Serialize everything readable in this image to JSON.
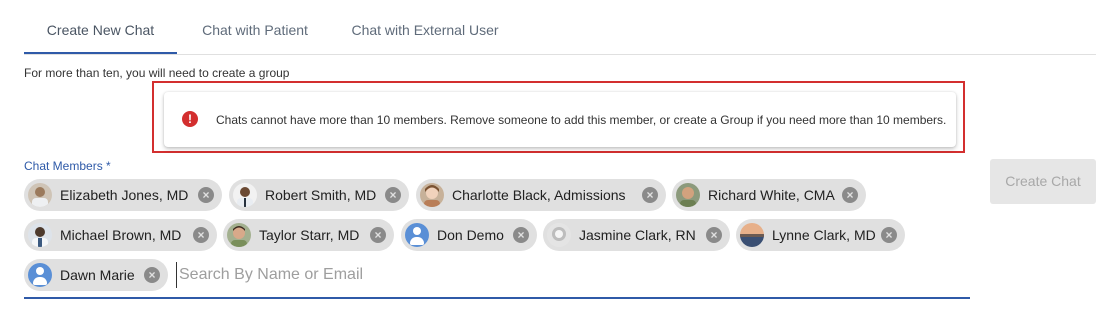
{
  "tabs": [
    {
      "label": "Create New Chat",
      "active": true
    },
    {
      "label": "Chat with Patient",
      "active": false
    },
    {
      "label": "Chat with External User",
      "active": false
    }
  ],
  "note": "For more than ten, you will need to create a group",
  "alert": {
    "icon": "error-icon",
    "message": "Chats cannot have more than 10 members. Remove someone to add this member, or create a Group if you need more than 10 members."
  },
  "members_field": {
    "label": "Chat Members *",
    "placeholder": "Search By Name or Email",
    "value": ""
  },
  "members": [
    {
      "name": "Elizabeth Jones, MD",
      "avatar": "photo"
    },
    {
      "name": "Robert Smith, MD",
      "avatar": "photo"
    },
    {
      "name": "Charlotte Black, Admissions",
      "avatar": "photo"
    },
    {
      "name": "Richard White, CMA",
      "avatar": "photo"
    },
    {
      "name": "Michael Brown, MD",
      "avatar": "photo"
    },
    {
      "name": "Taylor Starr, MD",
      "avatar": "photo"
    },
    {
      "name": "Don Demo",
      "avatar": "generic-user-icon"
    },
    {
      "name": "Jasmine Clark, RN",
      "avatar": "photo"
    },
    {
      "name": "Lynne Clark, MD",
      "avatar": "photo"
    },
    {
      "name": "Dawn Marie",
      "avatar": "generic-user-icon"
    }
  ],
  "actions": {
    "create_chat_label": "Create Chat",
    "create_chat_disabled": true
  },
  "colors": {
    "accent": "#2f5aa8",
    "error": "#d32f2f",
    "chip_bg": "#e0e0e0",
    "button_disabled_bg": "#e6e6e6"
  }
}
